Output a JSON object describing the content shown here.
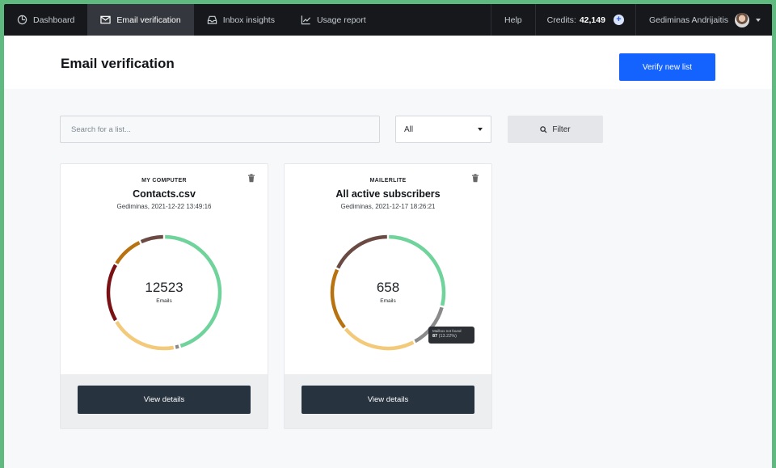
{
  "nav": {
    "items": [
      {
        "label": "Dashboard",
        "icon": "dashboard-icon"
      },
      {
        "label": "Email verification",
        "icon": "envelope-check-icon",
        "active": true
      },
      {
        "label": "Inbox insights",
        "icon": "inbox-icon"
      },
      {
        "label": "Usage report",
        "icon": "chart-line-icon"
      }
    ],
    "help": "Help",
    "credits_label": "Credits:",
    "credits_value": "42,149",
    "user_name": "Gediminas Andrijaitis"
  },
  "page": {
    "title": "Email verification",
    "verify_button": "Verify new list"
  },
  "filters": {
    "search_placeholder": "Search for a list...",
    "select_value": "All",
    "filter_button": "Filter"
  },
  "cards": [
    {
      "source": "MY COMPUTER",
      "title": "Contacts.csv",
      "meta": "Gediminas, 2021-12-22 13:49:16",
      "count": "12523",
      "count_label": "Emails",
      "button": "View details",
      "segments": [
        {
          "color": "#6fd39b",
          "fraction": 0.455
        },
        {
          "color": "#8a8a8a",
          "fraction": 0.015
        },
        {
          "color": "#f3c97a",
          "fraction": 0.195
        },
        {
          "color": "#7a1114",
          "fraction": 0.17
        },
        {
          "color": "#b8720f",
          "fraction": 0.095
        },
        {
          "color": "#6b4a44",
          "fraction": 0.07
        }
      ]
    },
    {
      "source": "MAILERLITE",
      "title": "All active subscribers",
      "meta": "Gediminas, 2021-12-17 18:26:21",
      "count": "658",
      "count_label": "Emails",
      "button": "View details",
      "tooltip_title": "Mailbox not found",
      "tooltip_value": "87",
      "tooltip_pct": "(13.22%)",
      "segments": [
        {
          "color": "#6fd39b",
          "fraction": 0.29
        },
        {
          "color": "#8a8a8a",
          "fraction": 0.1322
        },
        {
          "color": "#f3c97a",
          "fraction": 0.2178
        },
        {
          "color": "#b8720f",
          "fraction": 0.18
        },
        {
          "color": "#6b4a44",
          "fraction": 0.18
        }
      ]
    }
  ]
}
